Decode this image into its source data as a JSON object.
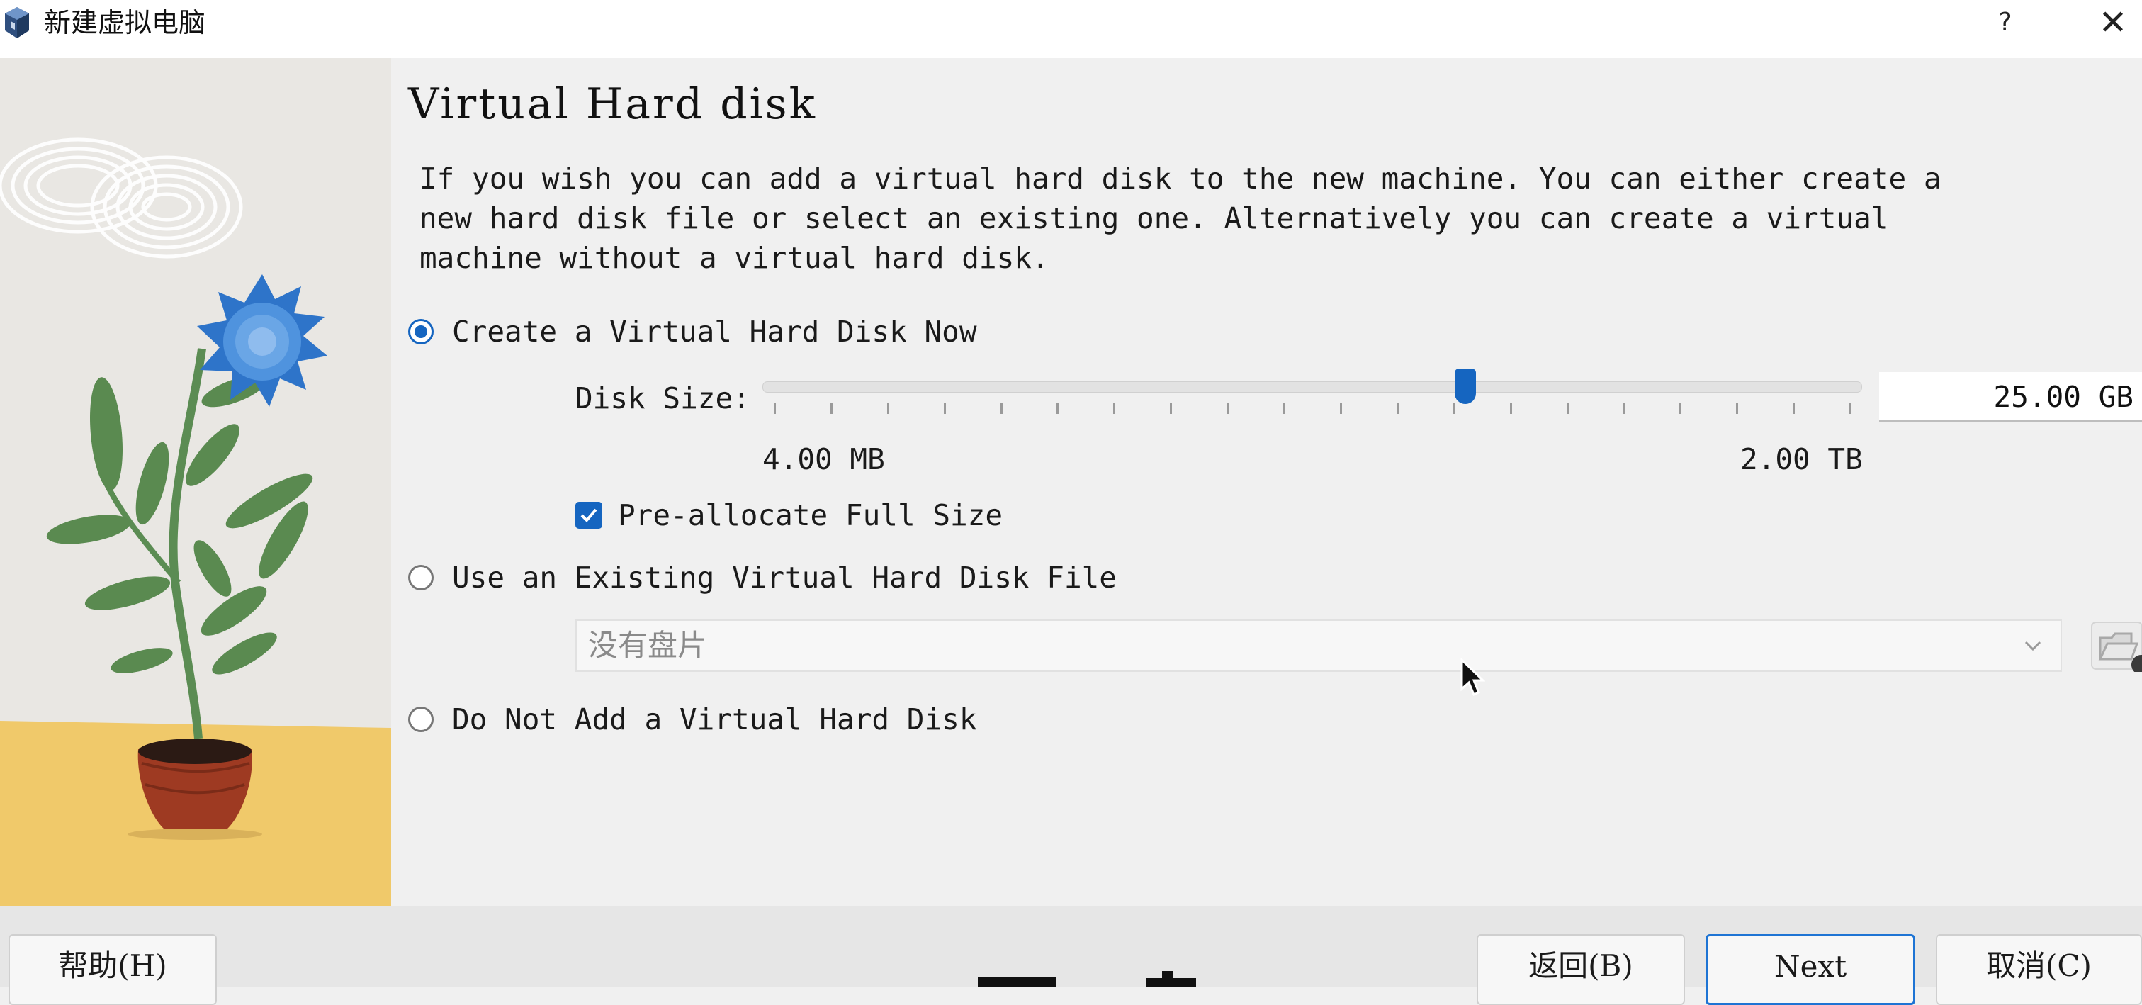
{
  "window": {
    "title": "新建虚拟电脑",
    "help_label": "?",
    "close_label": "✕"
  },
  "page": {
    "heading": "Virtual Hard disk",
    "description": "If you wish you can add a virtual hard disk to the new machine. You can either create a\nnew hard disk file or select an existing one. Alternatively you can create a virtual\nmachine without a virtual hard disk."
  },
  "options": {
    "create_now": {
      "label": "Create a Virtual Hard Disk Now",
      "selected": true
    },
    "use_existing": {
      "label": "Use an Existing Virtual Hard Disk File",
      "selected": false
    },
    "do_not_add": {
      "label": "Do Not Add a Virtual Hard Disk",
      "selected": false
    }
  },
  "disk_size": {
    "label": "Disk Size:",
    "value": "25.00 GB",
    "min_label": "4.00 MB",
    "max_label": "2.00 TB",
    "slider_fraction": 0.64
  },
  "preallocate": {
    "label": "Pre-allocate Full Size",
    "checked": true
  },
  "existing_disk": {
    "selected_value": "没有盘片"
  },
  "buttons": {
    "help": "帮助(H)",
    "back": "返回(B)",
    "next": "Next",
    "cancel": "取消(C)"
  },
  "colors": {
    "accent": "#1565c0",
    "illustration_ground": "#f0c96a"
  },
  "icons": [
    "virtualbox-app-icon",
    "help-icon",
    "close-icon",
    "chevron-down-icon",
    "folder-icon",
    "mouse-pointer-icon"
  ]
}
